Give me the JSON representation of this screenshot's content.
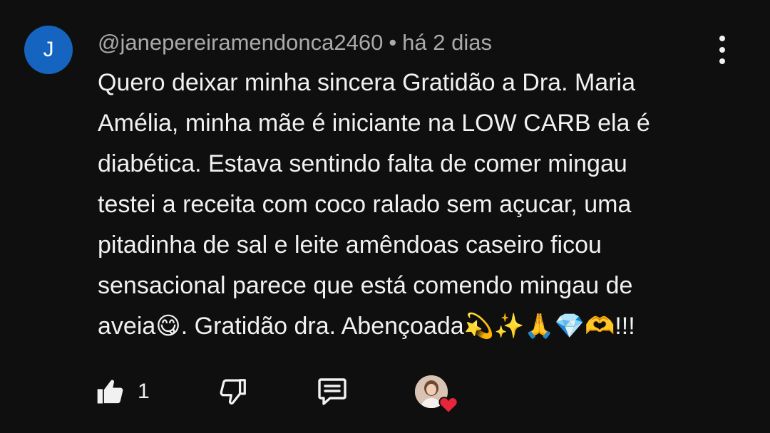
{
  "comment": {
    "avatar_letter": "J",
    "author": "@janepereiramendonca2460",
    "separator": "•",
    "time": "há 2 dias",
    "text": "Quero deixar minha sincera Gratidão a Dra. Maria\nAmélia, minha mãe é iniciante na LOW CARB ela é\ndiabética. Estava sentindo falta de comer mingau\ntestei a receita com coco ralado sem açucar, uma\npitadinha de sal e leite amêndoas caseiro ficou\nsensacional parece que está comendo mingau de\naveia😋. Gratidão dra. Abençoada💫✨🙏💎🫶!!!",
    "like_count": "1",
    "avatar_color": "#1565c0",
    "heart_color": "#e8263b"
  },
  "icons": {
    "like": "thumbs-up-icon",
    "dislike": "thumbs-down-icon",
    "reply": "comment-icon",
    "menu": "more-vertical-icon",
    "creator_heart": "creator-heart-icon"
  }
}
